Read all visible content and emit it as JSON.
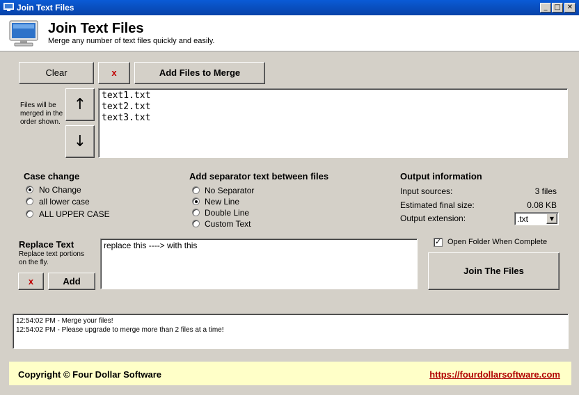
{
  "window": {
    "title": "Join Text Files",
    "minimize": "_",
    "maximize": "□",
    "close": "✕"
  },
  "header": {
    "title": "Join Text Files",
    "subtitle": "Merge any number of text files quickly and easily.",
    "icon": "monitor-icon"
  },
  "toolbar": {
    "clear_label": "Clear",
    "remove_label": "x",
    "add_files_label": "Add Files to Merge"
  },
  "order": {
    "note": "Files will be merged in the order shown.",
    "up": "↑",
    "down": "↓"
  },
  "files": [
    "text1.txt",
    "text2.txt",
    "text3.txt"
  ],
  "case_change": {
    "heading": "Case change",
    "options": [
      {
        "label": "No Change",
        "selected": true
      },
      {
        "label": "all lower case",
        "selected": false
      },
      {
        "label": "ALL UPPER CASE",
        "selected": false
      }
    ]
  },
  "separator": {
    "heading": "Add separator text between files",
    "options": [
      {
        "label": "No Separator",
        "selected": false
      },
      {
        "label": "New Line",
        "selected": true
      },
      {
        "label": "Double Line",
        "selected": false
      },
      {
        "label": "Custom Text",
        "selected": false
      }
    ]
  },
  "output": {
    "heading": "Output information",
    "input_sources_label": "Input sources:",
    "input_sources_value": "3 files",
    "final_size_label": "Estimated final size:",
    "final_size_value": "0.08 KB",
    "extension_label": "Output extension:",
    "extension_value": ".txt"
  },
  "replace": {
    "heading": "Replace Text",
    "note": "Replace text portions on the fly.",
    "remove_label": "x",
    "add_label": "Add",
    "text": "replace this ----> with this"
  },
  "open_folder": {
    "label": "Open Folder When Complete",
    "checked": true
  },
  "join_label": "Join The Files",
  "log": [
    "12:54:02 PM - Merge your files!",
    "12:54:02 PM - Please upgrade to merge more than 2 files at a time!"
  ],
  "footer": {
    "copyright": "Copyright © Four Dollar Software",
    "link": "https://fourdollarsoftware.com"
  }
}
